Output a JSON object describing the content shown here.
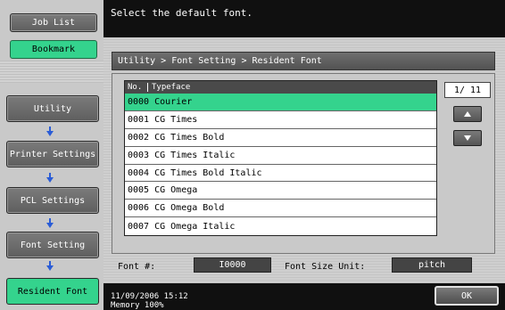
{
  "left": {
    "job_list": "Job List",
    "bookmark": "Bookmark",
    "steps": [
      "Utility",
      "Printer Settings",
      "PCL Settings",
      "Font Setting",
      "Resident Font"
    ]
  },
  "header": {
    "message": "Select the default font."
  },
  "breadcrumb": "Utility > Font Setting > Resident Font",
  "list": {
    "col_no": "No.",
    "col_typeface": "Typeface",
    "rows": [
      "0000 Courier",
      "0001 CG Times",
      "0002 CG Times Bold",
      "0003 CG Times Italic",
      "0004 CG Times Bold Italic",
      "0005 CG Omega",
      "0006 CG Omega Bold",
      "0007 CG Omega Italic"
    ],
    "selected_index": 0
  },
  "pager": {
    "page": "1/ 11"
  },
  "bottom_fields": {
    "font_label": "Font #:",
    "font_value": "I0000",
    "size_unit_label": "Font Size Unit:",
    "size_unit_value": "pitch"
  },
  "footer": {
    "datetime": "11/09/2006   15:12",
    "memory": "Memory       100%"
  },
  "ok_label": "OK",
  "colors": {
    "accent_green": "#34d38d",
    "dark_bar": "#101010",
    "arrow_blue": "#2a5cd6"
  }
}
